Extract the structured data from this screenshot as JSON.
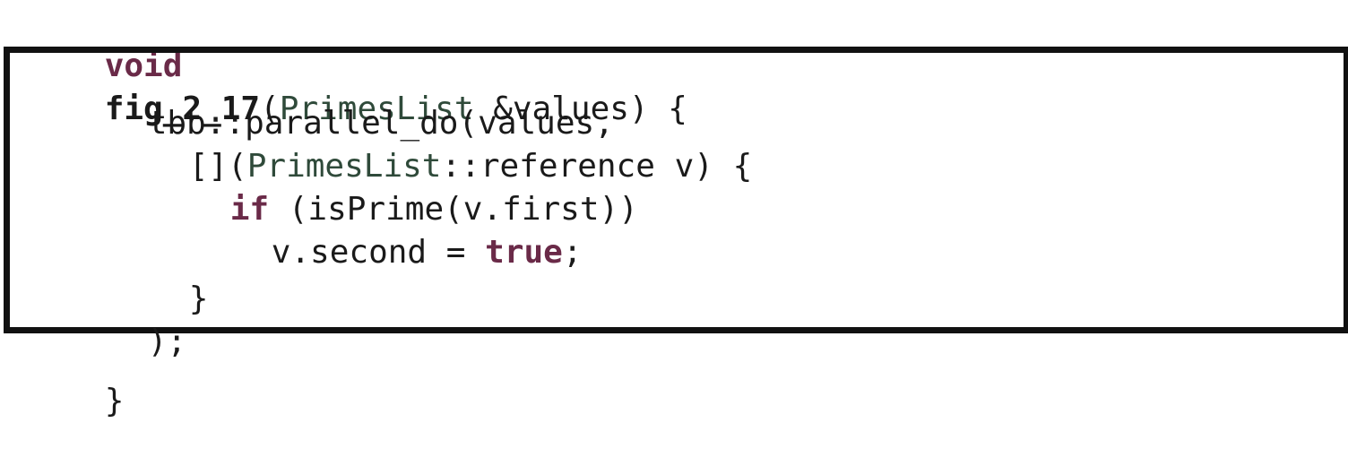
{
  "code": {
    "line1": {
      "kw_void": "void",
      "fn_name": "fig_2_17",
      "open_paren": "(",
      "param_type": "PrimesList",
      "param_rest": " &values) {"
    },
    "line2": {
      "text": "tbb::parallel_do(values,"
    },
    "line3": {
      "lambda_open": "[](",
      "param_type": "PrimesList",
      "param_rest": "::reference v) {"
    },
    "line4": {
      "kw_if": "if",
      "rest": " (isPrime(v.first))"
    },
    "line5": {
      "lhs": "v.second = ",
      "kw_true": "true",
      "semicolon": ";"
    },
    "line6": {
      "text": "}"
    },
    "line7": {
      "text": ");"
    },
    "line8": {
      "text": "}"
    }
  }
}
